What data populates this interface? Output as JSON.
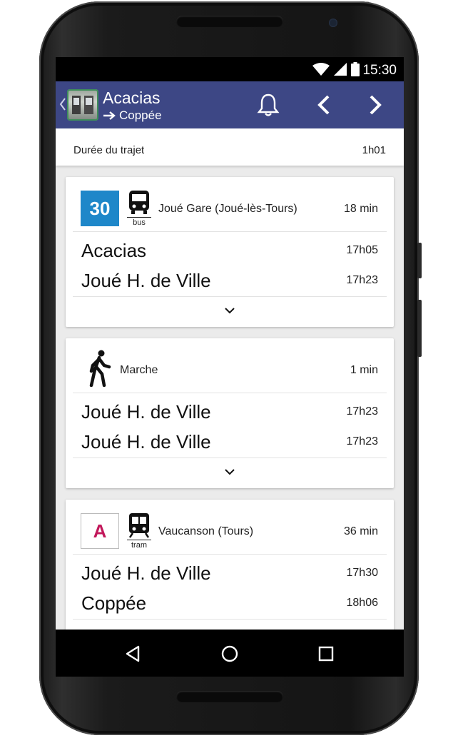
{
  "status_bar": {
    "time": "15:30",
    "icons": [
      "wifi-icon",
      "signal-icon",
      "battery-icon"
    ]
  },
  "header": {
    "stop": "Acacias",
    "destination": "Coppée",
    "icons": [
      "back-icon",
      "tram-thumbnail",
      "bell-icon",
      "chevron-left-icon",
      "chevron-right-icon"
    ],
    "color": "#3d4785"
  },
  "trip": {
    "duration_label": "Durée du trajet",
    "duration_value": "1h01"
  },
  "legs": [
    {
      "line": "30",
      "line_color": "#1e87c9",
      "mode": "bus",
      "direction": "Joué Gare (Joué-lès-Tours)",
      "duration": "18 min",
      "stops": [
        {
          "name": "Acacias",
          "time": "17h05"
        },
        {
          "name": "Joué H. de Ville",
          "time": "17h23"
        }
      ]
    },
    {
      "mode_label": "Marche",
      "duration": "1 min",
      "stops": [
        {
          "name": "Joué H. de Ville",
          "time": "17h23"
        },
        {
          "name": "Joué H. de Ville",
          "time": "17h23"
        }
      ]
    },
    {
      "line": "A",
      "line_color": "#c2185b",
      "mode": "tram",
      "direction": "Vaucanson (Tours)",
      "duration": "36 min",
      "stops": [
        {
          "name": "Joué H. de Ville",
          "time": "17h30"
        },
        {
          "name": "Coppée",
          "time": "18h06"
        }
      ]
    }
  ],
  "nav_bar": {
    "icons": [
      "back-triangle-icon",
      "home-circle-icon",
      "recents-square-icon"
    ]
  }
}
